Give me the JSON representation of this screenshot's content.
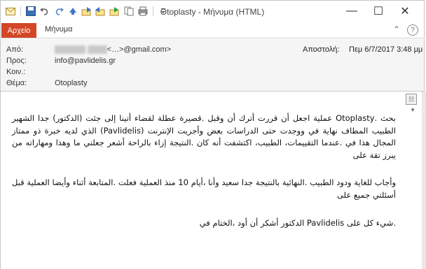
{
  "window": {
    "title": "Otoplasty - Μήνυμα (HTML)",
    "controls": {
      "minimize": "—",
      "maximize": "☐",
      "close": "✕"
    }
  },
  "qat_icons": [
    "mail-icon",
    "save-icon",
    "undo-icon",
    "redo-icon",
    "up-icon",
    "move-icon",
    "forward-icon",
    "reply-all-icon",
    "copy-icon",
    "print-icon",
    "customize-icon"
  ],
  "ribbon": {
    "file_tab": "Αρχείο",
    "message_tab": "Μήνυμα",
    "help": "?"
  },
  "headers": {
    "from_label": "Από:",
    "from_value": "<…>@gmail.com>",
    "to_label": "Προς:",
    "to_value": "info@pavlidelis.gr",
    "cc_label": "Κοιν.:",
    "subject_label": "Θέμα:",
    "subject_value": "Otoplasty",
    "sent_label": "Αποστολή:",
    "sent_value": "Πεμ 6/7/2017 3:48 μμ"
  },
  "body": {
    "p1": "بحث .Otoplasty عملية اجعل أن قررت أترك أن وقبل .قصيرة عطلة لقضاء أتينا إلى جئت (الدكتور) جدا الشهير الطبيب المطاف نهاية في ووجدت حتى الدراسات بعض وأجريت الإنترنت (Pavlidelis) الذي لديه خبرة ذو ممتاز المجال هذا في .عندما التقييمات، الطبيب، اكتشفت أنه كان .النتيجة إزاء بالراحة أشعر جعلني ما وهذا ومهاراته من يبرز تقة على",
    "p2": "وأجاب للغاية ودود الطبيب .النهائية بالنتيجة جدا سعيد وأنا ،أيام 10 منذ العملية فعلت .المتابعة أثناء وأيضا العملية قبل أسئلتي جميع على",
    "p3": ".شيء كل على Pavlidelis الدكتور أشكر أن أود ،الختام في"
  }
}
